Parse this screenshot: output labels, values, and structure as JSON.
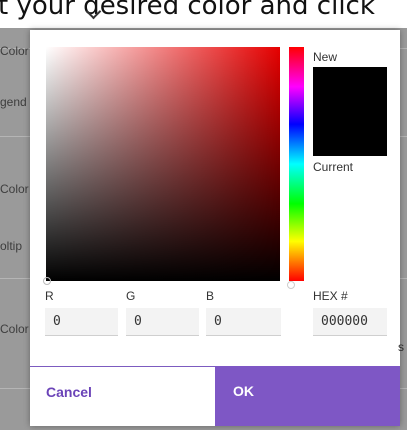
{
  "background": {
    "instruction": "t your desired color and click",
    "labels": [
      "Color",
      "gend",
      "Color",
      "oltip",
      "Color"
    ]
  },
  "picker": {
    "hue_color": "#e60000",
    "new_label": "New",
    "current_label": "Current",
    "new_color": "#000000",
    "current_color": "#000000",
    "r_label": "R",
    "g_label": "G",
    "b_label": "B",
    "hex_label": "HEX #",
    "r_value": "0",
    "g_value": "0",
    "b_value": "0",
    "hex_value": "000000"
  },
  "buttons": {
    "cancel_label": "Cancel",
    "ok_label": "OK"
  },
  "colors": {
    "accent": "#7e57c5",
    "accent_text": "#6b44b8"
  }
}
